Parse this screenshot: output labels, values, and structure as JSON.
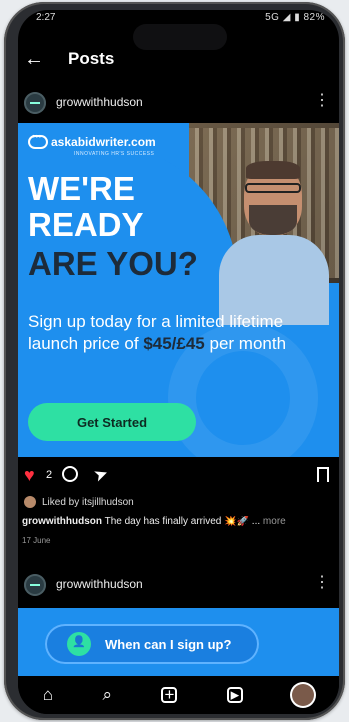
{
  "status": {
    "time": "2:27",
    "right": "5G ◢ ▮ 82%"
  },
  "header": {
    "back_icon": "←",
    "title": "Posts"
  },
  "post1": {
    "username": "growwithhudson",
    "ad": {
      "logo": "askabidwriter.com",
      "tagline": "INNOVATING HR'S SUCCESS",
      "line1": "WE'RE",
      "line2": "READY",
      "line3": "ARE YOU?",
      "sub1": "Sign up today for a limited lifetime launch price of",
      "price": "$45/£45",
      "sub2": "per month",
      "cta": "Get Started"
    },
    "like_count": "2",
    "liked_by": "Liked by itsjillhudson",
    "caption_user": "growwithhudson",
    "caption_text": "The day has finally arrived 💥🚀 ...",
    "caption_more": "more",
    "date": "17 June"
  },
  "post2": {
    "username": "growwithhudson",
    "cta": "When can I sign up?"
  },
  "colors": {
    "accent": "#1e8fee",
    "cta": "#2ee0a3",
    "like": "#ff3040"
  }
}
